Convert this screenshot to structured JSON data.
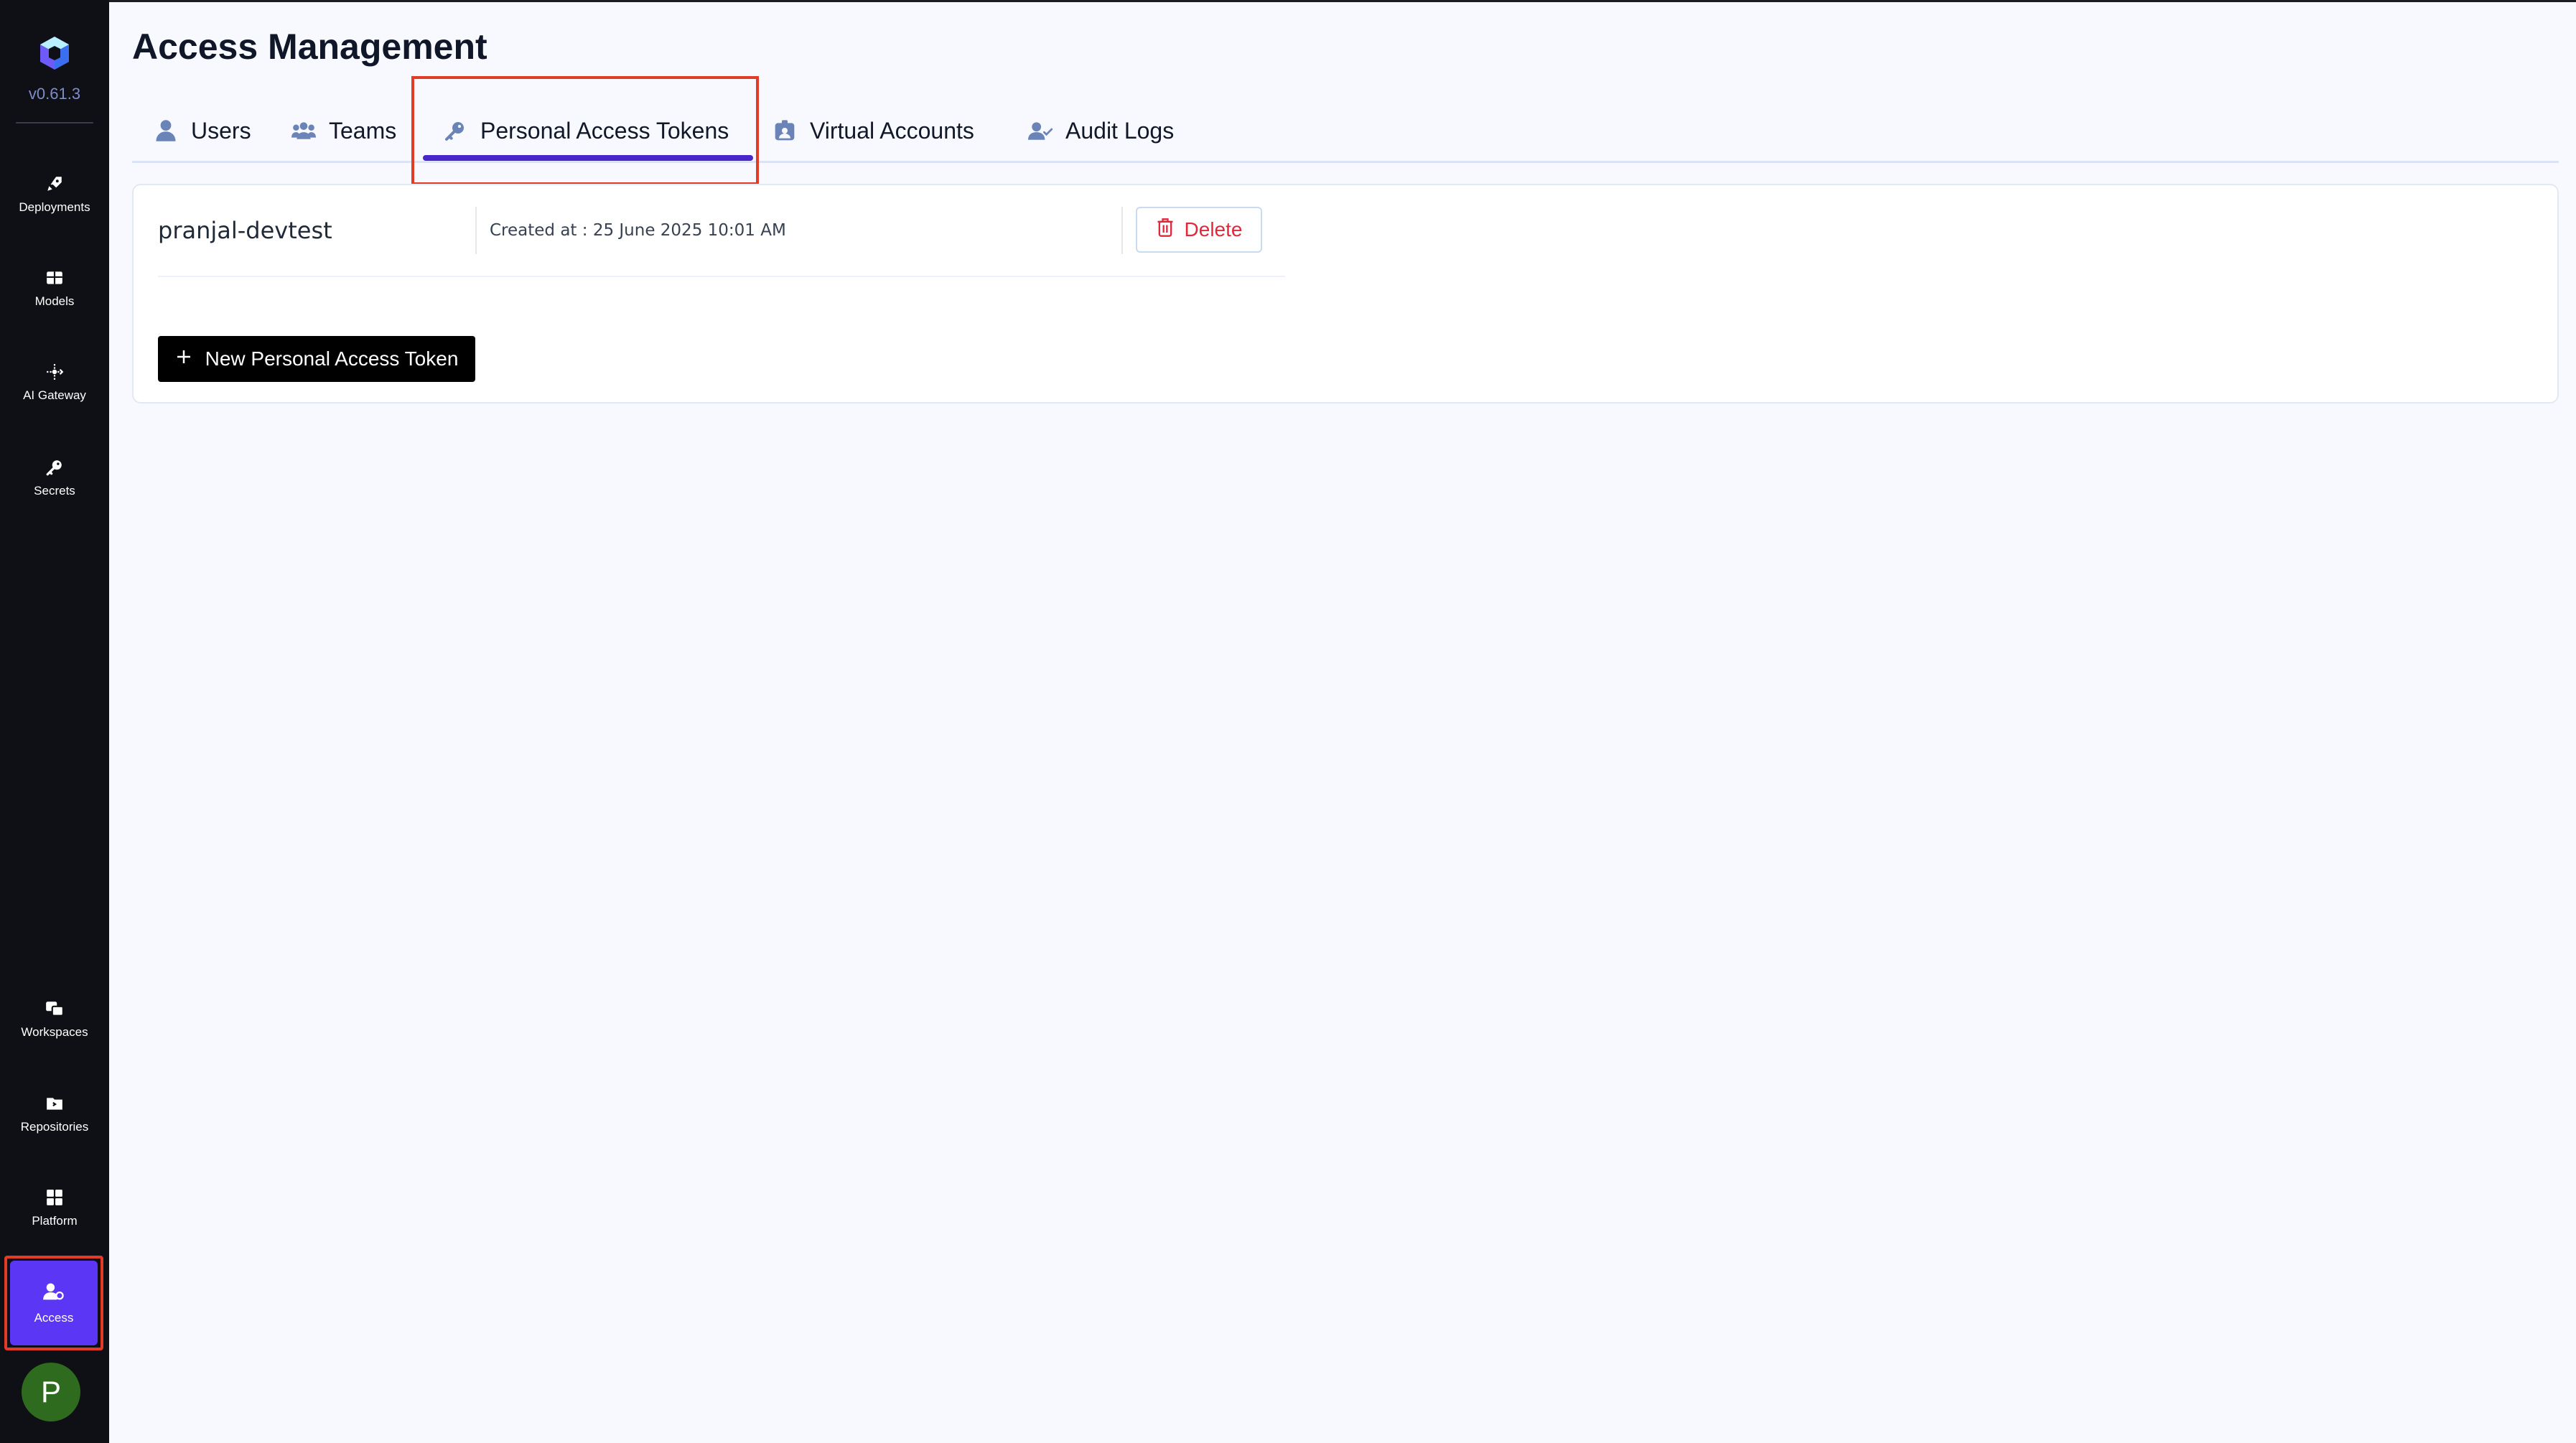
{
  "app": {
    "version": "v0.61.3",
    "brand_color": "#5b36f5"
  },
  "sidebar": {
    "top_items": [
      {
        "label": "Deployments",
        "icon": "rocket-icon"
      },
      {
        "label": "Models",
        "icon": "grid-icon"
      },
      {
        "label": "AI Gateway",
        "icon": "gateway-icon"
      },
      {
        "label": "Secrets",
        "icon": "key-icon"
      }
    ],
    "bottom_items": [
      {
        "label": "Workspaces",
        "icon": "workspaces-icon"
      },
      {
        "label": "Repositories",
        "icon": "folder-icon"
      },
      {
        "label": "Platform",
        "icon": "apps-icon"
      }
    ],
    "active_item": {
      "label": "Access",
      "icon": "user-key-icon"
    },
    "avatar_initial": "P"
  },
  "page": {
    "title": "Access Management"
  },
  "tabs": [
    {
      "label": "Users",
      "icon": "user-icon"
    },
    {
      "label": "Teams",
      "icon": "users-icon"
    },
    {
      "label": "Personal Access Tokens",
      "icon": "key-icon",
      "active": true
    },
    {
      "label": "Virtual Accounts",
      "icon": "id-badge-icon"
    },
    {
      "label": "Audit Logs",
      "icon": "user-check-icon"
    }
  ],
  "tokens": [
    {
      "name": "pranjal-devtest",
      "created": "Created at : 25 June 2025 10:01 AM",
      "delete_label": "Delete"
    }
  ],
  "actions": {
    "new_token_label": "New Personal Access Token"
  },
  "colors": {
    "delete": "#e0283c",
    "active_tab_underline": "#4a25c9",
    "highlight_box": "#e23b26"
  }
}
